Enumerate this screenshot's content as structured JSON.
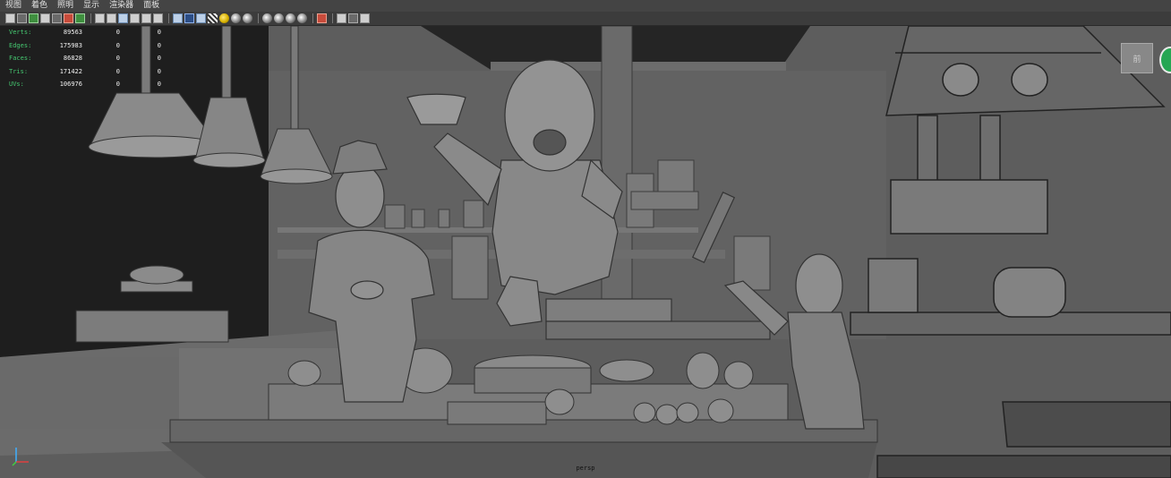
{
  "menu": {
    "items": [
      {
        "id": "view",
        "label": "视图"
      },
      {
        "id": "shading",
        "label": "着色"
      },
      {
        "id": "lighting",
        "label": "照明"
      },
      {
        "id": "show",
        "label": "显示"
      },
      {
        "id": "renderer",
        "label": "渲染器"
      },
      {
        "id": "panels",
        "label": "面板"
      }
    ]
  },
  "toolbar": {
    "icons": [
      "select-camera-icon",
      "camera-attributes-icon",
      "bookmark-icon",
      "image-plane-icon",
      "2d-pan-zoom-icon",
      "grease-pencil-icon",
      "grid-icon",
      "film-gate-icon",
      "resolution-gate-icon",
      "gate-mask-icon",
      "field-chart-icon",
      "safe-action-icon",
      "safe-title-icon",
      "wireframe-icon",
      "smooth-shade-icon",
      "default-material-icon",
      "textured-icon",
      "use-all-lights-icon",
      "shadows-icon",
      "screen-space-ao-icon",
      "motion-blur-icon",
      "multisample-aa-icon",
      "depth-of-field-icon",
      "isolate-select-icon",
      "xray-icon",
      "xray-joints-icon",
      "xray-components-icon",
      "camera-sequencer-icon"
    ]
  },
  "hud": {
    "rows": [
      {
        "label": "Verts:",
        "total": "89563",
        "selected": "0",
        "components": "0"
      },
      {
        "label": "Edges:",
        "total": "175983",
        "selected": "0",
        "components": "0"
      },
      {
        "label": "Faces:",
        "total": "86828",
        "selected": "0",
        "components": "0"
      },
      {
        "label": "Tris:",
        "total": "171422",
        "selected": "0",
        "components": "0"
      },
      {
        "label": "UVs:",
        "total": "106976",
        "selected": "0",
        "components": "0"
      }
    ]
  },
  "viewport": {
    "camera_label": "persp",
    "view_cube_label": "前"
  },
  "colors": {
    "background": "#5e5e5e",
    "hud_label": "#45c870",
    "hud_value": "#f2f2f2",
    "menubar": "#444444",
    "toolbar": "#3c3c3c",
    "view_cube_compass": "#26a653"
  }
}
